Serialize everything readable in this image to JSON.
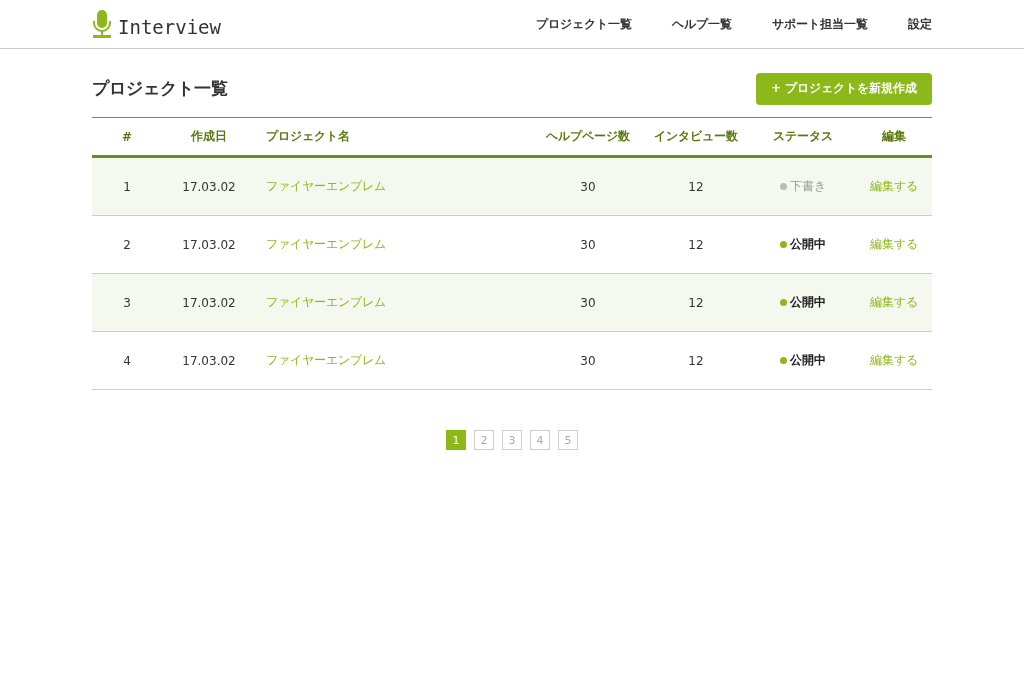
{
  "header": {
    "logo": "Interview",
    "nav": [
      {
        "label": "プロジェクト一覧"
      },
      {
        "label": "ヘルプ一覧"
      },
      {
        "label": "サポート担当一覧"
      },
      {
        "label": "設定"
      }
    ]
  },
  "page": {
    "title": "プロジェクト一覧",
    "create_button": "+ プロジェクトを新規作成"
  },
  "table": {
    "columns": [
      "#",
      "作成日",
      "プロジェクト名",
      "ヘルプページ数",
      "インタビュー数",
      "ステータス",
      "編集"
    ],
    "rows": [
      {
        "number": "1",
        "date": "17.03.02",
        "name": "ファイヤーエンブレム",
        "help_pages": "30",
        "interviews": "12",
        "status": {
          "kind": "draft",
          "label": "下書き",
          "color": "#bbbbbb"
        },
        "edit": "編集する"
      },
      {
        "number": "2",
        "date": "17.03.02",
        "name": "ファイヤーエンブレム",
        "help_pages": "30",
        "interviews": "12",
        "status": {
          "kind": "published",
          "label": "公開中",
          "color": "#8cb81a"
        },
        "edit": "編集する"
      },
      {
        "number": "3",
        "date": "17.03.02",
        "name": "ファイヤーエンブレム",
        "help_pages": "30",
        "interviews": "12",
        "status": {
          "kind": "published",
          "label": "公開中",
          "color": "#8cb81a"
        },
        "edit": "編集する"
      },
      {
        "number": "4",
        "date": "17.03.02",
        "name": "ファイヤーエンブレム",
        "help_pages": "30",
        "interviews": "12",
        "status": {
          "kind": "published",
          "label": "公開中",
          "color": "#8cb81a"
        },
        "edit": "編集する"
      }
    ]
  },
  "pagination": [
    {
      "label": "1",
      "selected": true
    },
    {
      "label": "2",
      "selected": false
    },
    {
      "label": "3",
      "selected": false
    },
    {
      "label": "4",
      "selected": false
    },
    {
      "label": "5",
      "selected": false
    }
  ]
}
